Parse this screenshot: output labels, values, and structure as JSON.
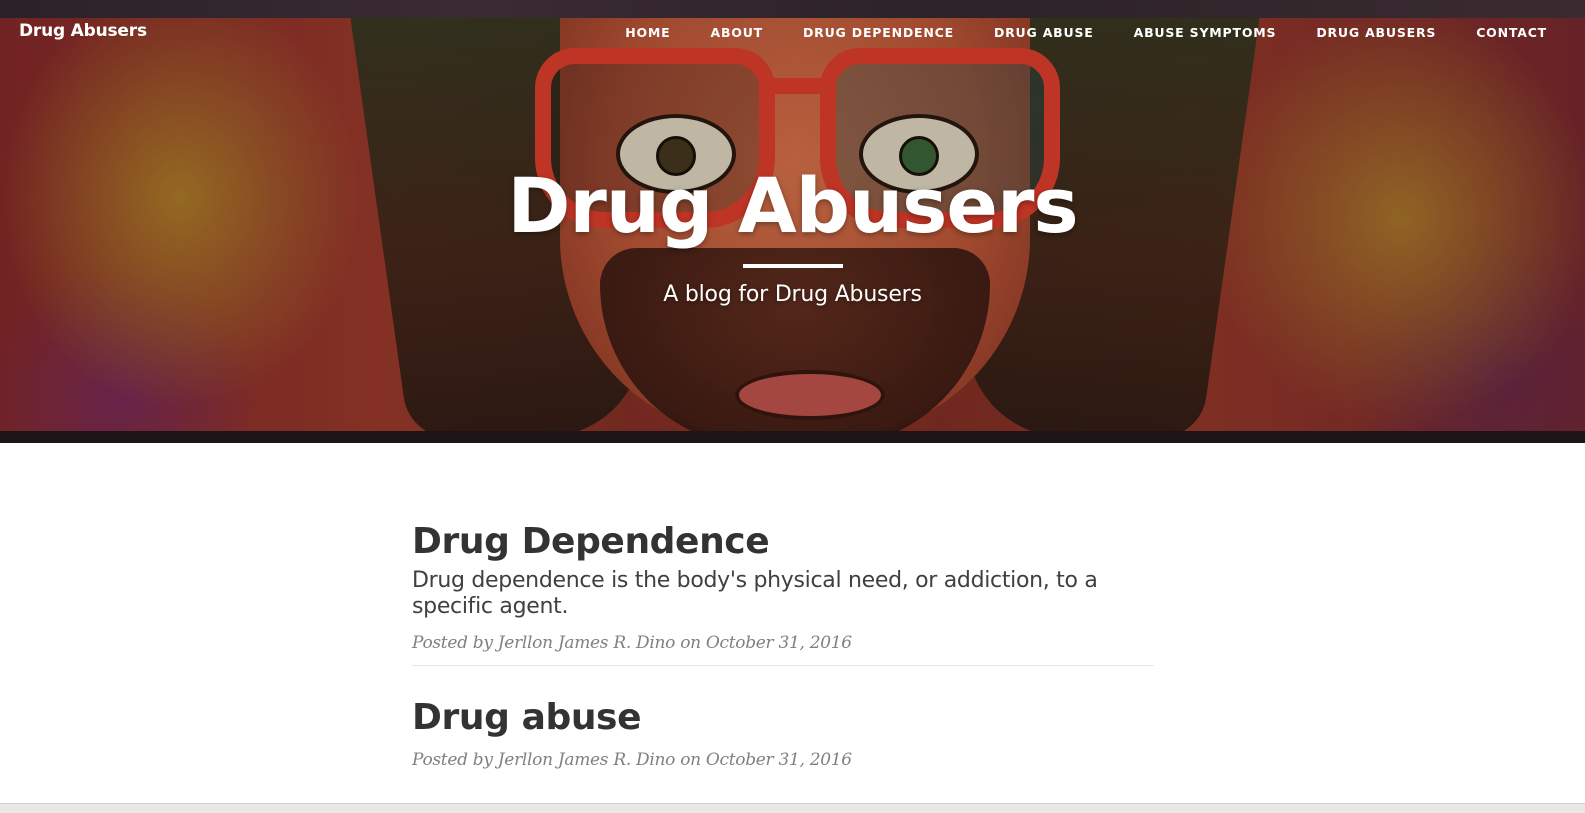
{
  "navbar": {
    "brand": "Drug Abusers",
    "items": [
      {
        "label": "HOME"
      },
      {
        "label": "ABOUT"
      },
      {
        "label": "DRUG DEPENDENCE"
      },
      {
        "label": "DRUG ABUSE"
      },
      {
        "label": "ABUSE SYMPTOMS"
      },
      {
        "label": "DRUG ABUSERS"
      },
      {
        "label": "CONTACT"
      }
    ]
  },
  "header": {
    "title": "Drug Abusers",
    "subtitle": "A blog for Drug Abusers"
  },
  "posts": [
    {
      "title": "Drug Dependence",
      "subtitle": "Drug dependence is the body's physical need, or addiction, to a specific agent.",
      "meta_prefix": "Posted by",
      "author": "Jerllon James R. Dino",
      "meta_on": "on",
      "date": "October 31, 2016"
    },
    {
      "title": "Drug abuse",
      "meta_prefix": "Posted by",
      "author": "Jerllon James R. Dino",
      "meta_on": "on",
      "date": "October 31, 2016"
    }
  ],
  "colors": {
    "heading": "#333333",
    "meta": "#808080",
    "glasses_accent": "#e8402e"
  }
}
